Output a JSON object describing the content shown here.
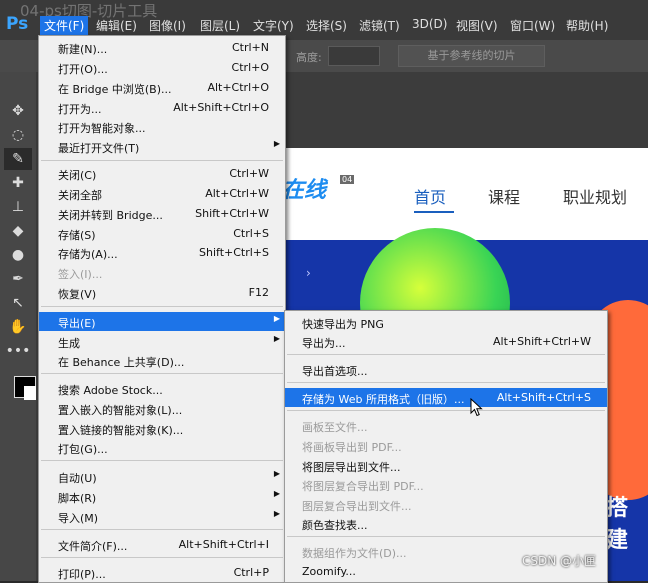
{
  "watermark_title": "04-ps切图-切片工具",
  "app_logo": "Ps",
  "menubar": [
    {
      "label": "文件(F)",
      "active": true
    },
    {
      "label": "编辑(E)"
    },
    {
      "label": "图像(I)"
    },
    {
      "label": "图层(L)"
    },
    {
      "label": "文字(Y)"
    },
    {
      "label": "选择(S)"
    },
    {
      "label": "滤镜(T)"
    },
    {
      "label": "3D(D)"
    },
    {
      "label": "视图(V)"
    },
    {
      "label": "窗口(W)"
    },
    {
      "label": "帮助(H)"
    }
  ],
  "options_bar": {
    "height_label": "高度:",
    "slice_button": "基于参考线的切片"
  },
  "tools": [
    "move-icon",
    "lasso-icon",
    "slice-icon",
    "healing-icon",
    "stamp-icon",
    "eraser-icon",
    "blur-icon",
    "pen-icon",
    "path-select-icon",
    "hand-icon",
    "more-icon"
  ],
  "file_menu": [
    {
      "label": "新建(N)...",
      "shortcut": "Ctrl+N"
    },
    {
      "label": "打开(O)...",
      "shortcut": "Ctrl+O"
    },
    {
      "label": "在 Bridge 中浏览(B)...",
      "shortcut": "Alt+Ctrl+O"
    },
    {
      "label": "打开为...",
      "shortcut": "Alt+Shift+Ctrl+O"
    },
    {
      "label": "打开为智能对象...",
      "shortcut": ""
    },
    {
      "label": "最近打开文件(T)",
      "shortcut": "",
      "submenu": true
    },
    {
      "label": "关闭(C)",
      "shortcut": "Ctrl+W"
    },
    {
      "label": "关闭全部",
      "shortcut": "Alt+Ctrl+W"
    },
    {
      "label": "关闭并转到 Bridge...",
      "shortcut": "Shift+Ctrl+W"
    },
    {
      "label": "存储(S)",
      "shortcut": "Ctrl+S"
    },
    {
      "label": "存储为(A)...",
      "shortcut": "Shift+Ctrl+S"
    },
    {
      "label": "签入(I)...",
      "shortcut": "",
      "disabled": true
    },
    {
      "label": "恢复(V)",
      "shortcut": "F12"
    },
    {
      "label": "导出(E)",
      "shortcut": "",
      "submenu": true,
      "highlighted": true
    },
    {
      "label": "生成",
      "shortcut": "",
      "submenu": true
    },
    {
      "label": "在 Behance 上共享(D)...",
      "shortcut": ""
    },
    {
      "label": "搜索 Adobe Stock...",
      "shortcut": ""
    },
    {
      "label": "置入嵌入的智能对象(L)...",
      "shortcut": ""
    },
    {
      "label": "置入链接的智能对象(K)...",
      "shortcut": ""
    },
    {
      "label": "打包(G)...",
      "shortcut": ""
    },
    {
      "label": "自动(U)",
      "shortcut": "",
      "submenu": true
    },
    {
      "label": "脚本(R)",
      "shortcut": "",
      "submenu": true
    },
    {
      "label": "导入(M)",
      "shortcut": "",
      "submenu": true
    },
    {
      "label": "文件简介(F)...",
      "shortcut": "Alt+Shift+Ctrl+I"
    },
    {
      "label": "打印(P)...",
      "shortcut": "Ctrl+P"
    }
  ],
  "export_menu": [
    {
      "label": "快速导出为 PNG",
      "shortcut": ""
    },
    {
      "label": "导出为...",
      "shortcut": "Alt+Shift+Ctrl+W"
    },
    {
      "label": "导出首选项...",
      "shortcut": ""
    },
    {
      "label": "存储为 Web 所用格式（旧版）...",
      "shortcut": "Alt+Shift+Ctrl+S",
      "highlighted": true
    },
    {
      "label": "画板至文件...",
      "shortcut": "",
      "disabled": true
    },
    {
      "label": "将画板导出到 PDF...",
      "shortcut": "",
      "disabled": true
    },
    {
      "label": "将图层导出到文件...",
      "shortcut": ""
    },
    {
      "label": "将图层复合导出到 PDF...",
      "shortcut": "",
      "disabled": true
    },
    {
      "label": "图层复合导出到文件...",
      "shortcut": "",
      "disabled": true
    },
    {
      "label": "颜色查找表...",
      "shortcut": ""
    },
    {
      "label": "数据组作为文件(D)...",
      "shortcut": "",
      "disabled": true
    },
    {
      "label": "Zoomify...",
      "shortcut": ""
    }
  ],
  "webpage": {
    "logo_text": "在线",
    "slice_tag": "04",
    "nav": [
      "首页",
      "课程",
      "职业规划"
    ],
    "banner_text": "搭建"
  },
  "watermark": "CSDN @小匣"
}
